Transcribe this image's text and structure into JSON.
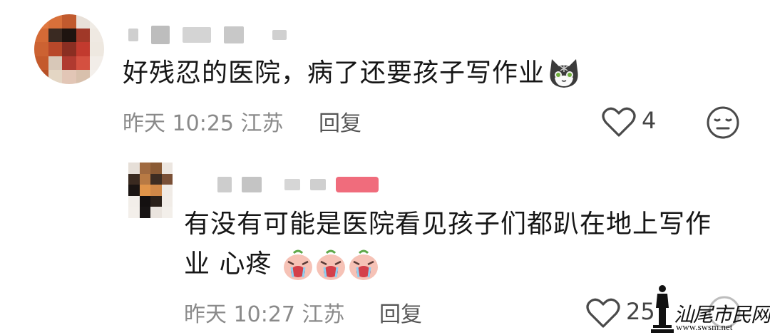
{
  "comment": {
    "text": "好残忍的医院，病了还要孩子写作业",
    "emoji": "cat-emoji",
    "time": "昨天 10:25",
    "location": "江苏",
    "reply_label": "回复",
    "like_count": "4"
  },
  "reply": {
    "text_line1": "有没有可能是医院看见孩子们都趴在地上写作",
    "text_line2": "业 心疼",
    "emoji": "crying-emoji",
    "emoji_count": 3,
    "time": "昨天 10:27",
    "location": "江苏",
    "reply_label": "回复",
    "like_count": "25"
  },
  "watermark": {
    "text": "汕尾市民网",
    "url": "www.swsm.net"
  },
  "colors": {
    "text": "#161616",
    "meta": "#8a8a8a",
    "icon": "#444444"
  }
}
